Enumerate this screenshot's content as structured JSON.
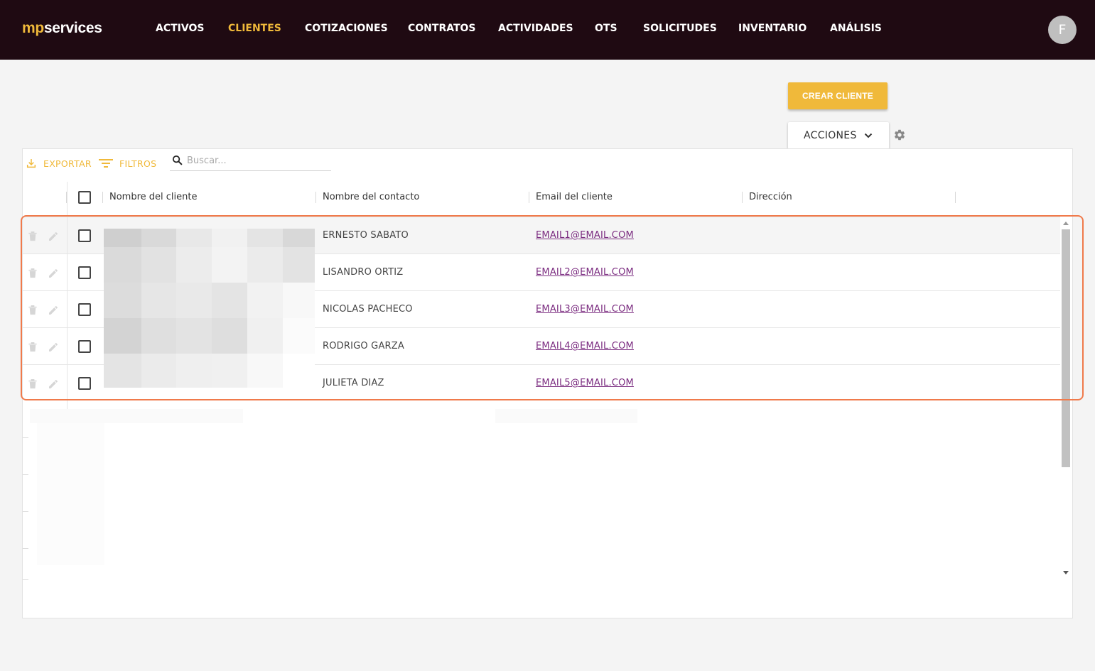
{
  "brand": {
    "part1": "mp",
    "part2": "services"
  },
  "nav": {
    "items": [
      {
        "label": "ACTIVOS",
        "active": false
      },
      {
        "label": "CLIENTES",
        "active": true
      },
      {
        "label": "COTIZACIONES",
        "active": false
      },
      {
        "label": "CONTRATOS",
        "active": false
      },
      {
        "label": "ACTIVIDADES",
        "active": false
      },
      {
        "label": "OTS",
        "active": false
      },
      {
        "label": "SOLICITUDES",
        "active": false
      },
      {
        "label": "INVENTARIO",
        "active": false
      },
      {
        "label": "ANÁLISIS",
        "active": false
      }
    ]
  },
  "user": {
    "initial": "F"
  },
  "actions": {
    "create_label": "CREAR CLIENTE",
    "menu_label": "ACCIONES"
  },
  "toolbar": {
    "export_label": "EXPORTAR",
    "filters_label": "FILTROS",
    "search_placeholder": "Buscar..."
  },
  "table": {
    "columns": [
      "Nombre del cliente",
      "Nombre del contacto",
      "Email del cliente",
      "Dirección"
    ],
    "rows": [
      {
        "contact": "ERNESTO SABATO",
        "email": "EMAIL1@EMAIL.COM"
      },
      {
        "contact": "LISANDRO ORTIZ",
        "email": "EMAIL2@EMAIL.COM"
      },
      {
        "contact": "NICOLAS PACHECO",
        "email": "EMAIL3@EMAIL.COM"
      },
      {
        "contact": "RODRIGO GARZA",
        "email": "EMAIL4@EMAIL.COM"
      },
      {
        "contact": "JULIETA DIAZ",
        "email": "EMAIL5@EMAIL.COM"
      }
    ]
  },
  "colors": {
    "accent": "#f0b93a",
    "topbar": "#1f0a12",
    "link": "#7b2c80",
    "highlight": "#f07a4b"
  },
  "icons": [
    "download-icon",
    "filter-icon",
    "search-icon",
    "chevron-down-icon",
    "gear-icon",
    "trash-icon",
    "pencil-icon"
  ]
}
